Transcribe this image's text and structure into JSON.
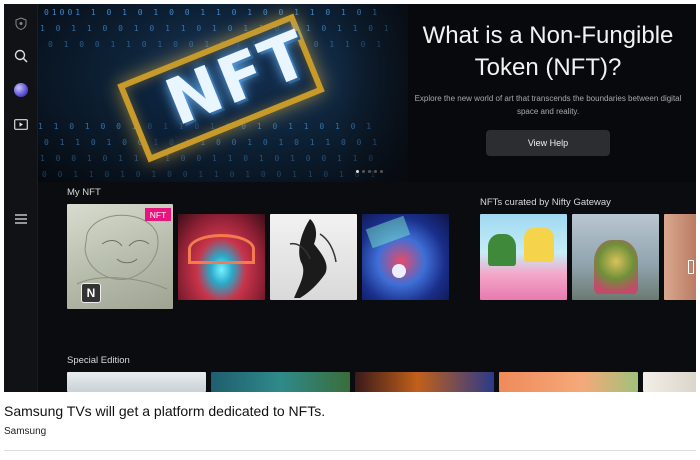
{
  "hero": {
    "title": "What is a Non-Fungible Token (NFT)?",
    "description": "Explore the new world of art that transcends the boundaries between digital space and reality.",
    "button_label": "View Help",
    "art_text": "NFT",
    "carousel": {
      "count": 5,
      "active": 1
    }
  },
  "sidebar": {
    "icons": [
      "shield-icon",
      "search-icon",
      "globe-icon",
      "media-icon",
      "menu-icon"
    ]
  },
  "rows": {
    "my_nft": {
      "title": "My NFT",
      "badge": "NFT",
      "logo_letter": "N"
    },
    "curated": {
      "title": "NFTs curated by Nifty Gateway"
    },
    "special": {
      "title": "Special Edition"
    }
  },
  "caption": {
    "text": "Samsung TVs will get a platform dedicated to NFTs.",
    "credit": "Samsung"
  },
  "colors": {
    "badge": "#e8157f",
    "background": "#0b0c10",
    "hero_frame": "#c79a2a"
  }
}
